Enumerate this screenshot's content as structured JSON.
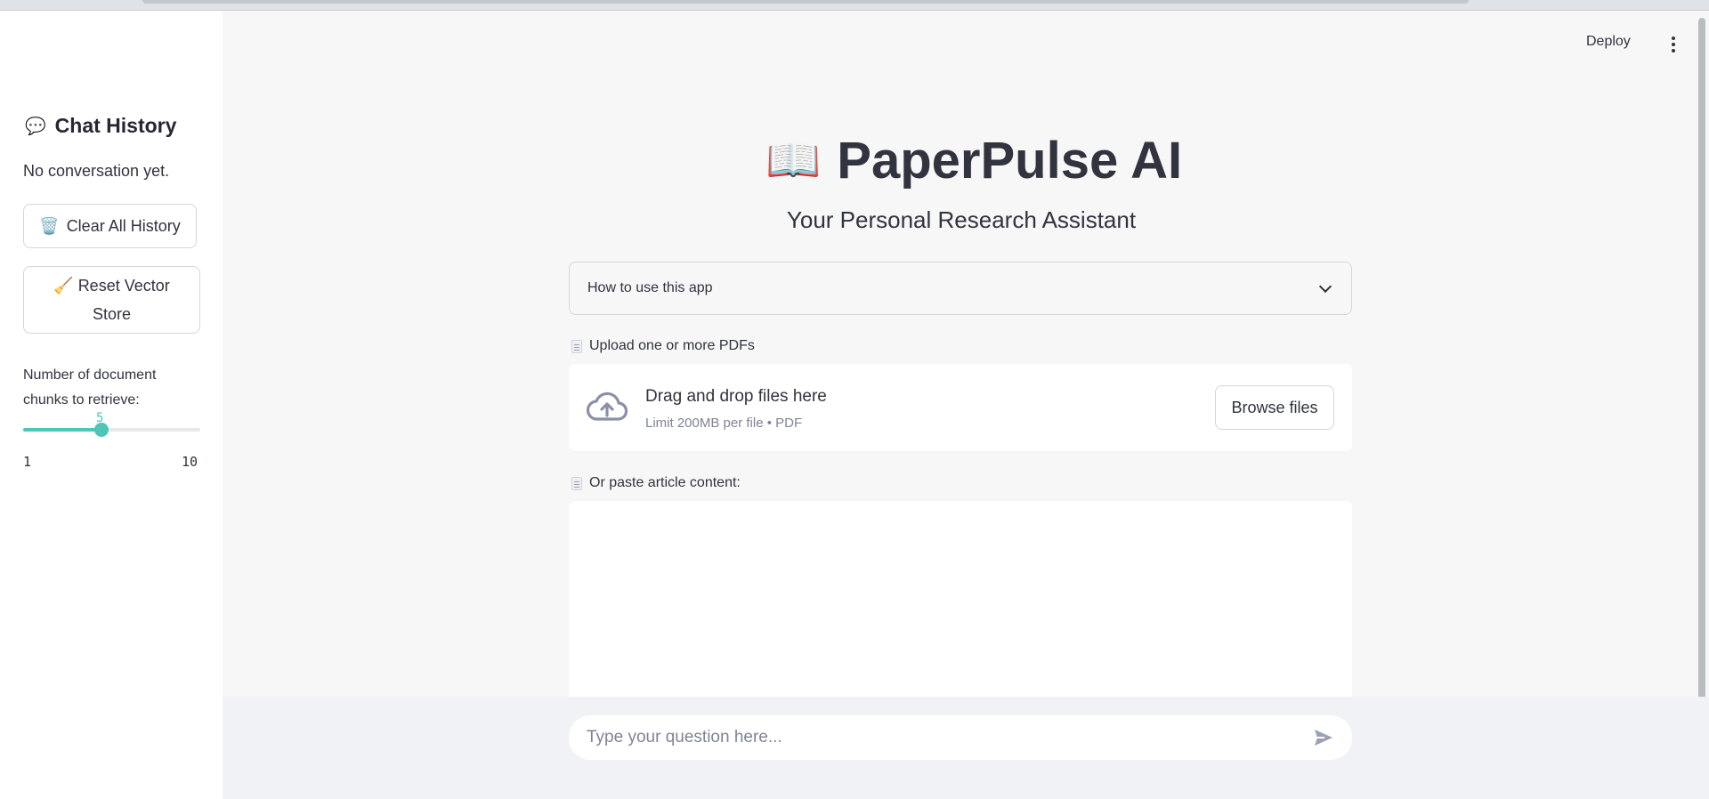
{
  "sidebar": {
    "title": "Chat History",
    "title_emoji": "💬",
    "empty_message": "No conversation yet.",
    "clear_button": {
      "emoji": "🗑️",
      "label": "Clear All History"
    },
    "reset_button": {
      "emoji": "🧹",
      "label": "Reset Vector Store"
    },
    "slider": {
      "label": "Number of document chunks to retrieve:",
      "value": "5",
      "min": "1",
      "max": "10",
      "fraction": 0.444
    }
  },
  "header": {
    "deploy_label": "Deploy",
    "menu_icon": "kebab-menu-icon"
  },
  "main": {
    "title_emoji": "📖",
    "title": "PaperPulse AI",
    "subtitle": "Your Personal Research Assistant",
    "expander_label": "How to use this app",
    "upload_label": "Upload one or more PDFs",
    "dropzone_main": "Drag and drop files here",
    "dropzone_sub": "Limit 200MB per file • PDF",
    "browse_label": "Browse files",
    "paste_label": "Or paste article content:"
  },
  "chat": {
    "placeholder": "Type your question here..."
  },
  "colors": {
    "accent": "#4ec5b6",
    "sidebar_bg": "#ffffff",
    "main_bg": "#f7f7f7",
    "bottom_bg": "#f0f2f6"
  }
}
